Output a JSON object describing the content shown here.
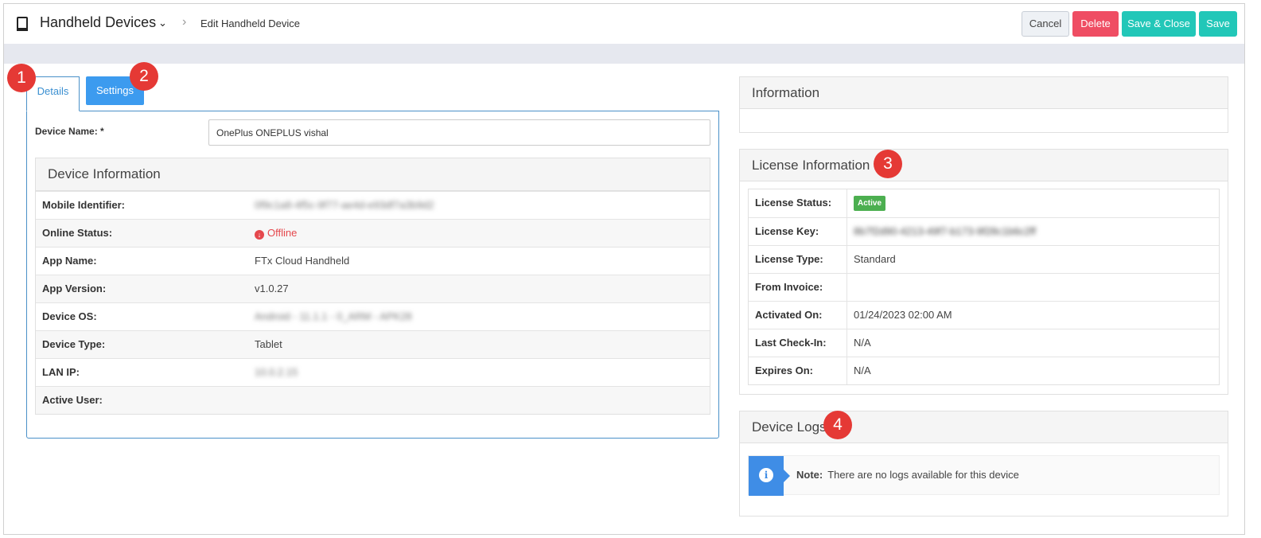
{
  "header": {
    "title": "Handheld Devices",
    "breadcrumb_sep": "›",
    "breadcrumb": "Edit Handheld Device",
    "cancel_label": "Cancel",
    "delete_label": "Delete",
    "save_close_label": "Save & Close",
    "save_label": "Save"
  },
  "tabs": [
    {
      "label": "Details",
      "active": true
    },
    {
      "label": "Settings",
      "active": false
    }
  ],
  "callouts": [
    "1",
    "2",
    "3",
    "4"
  ],
  "details": {
    "device_name_label": "Device Name: *",
    "device_name_value": "OnePlus ONEPLUS vishal",
    "device_info_title": "Device Information",
    "rows": [
      {
        "label": "Mobile Identifier:",
        "value": "0f9c1a8-4f5c-9f77-ae4d-e93df7a3b9d2",
        "blurred": true
      },
      {
        "label": "Online Status:",
        "value": "Offline",
        "status": "offline"
      },
      {
        "label": "App Name:",
        "value": "FTx Cloud Handheld"
      },
      {
        "label": "App Version:",
        "value": "v1.0.27"
      },
      {
        "label": "Device OS:",
        "value": "Android - 11.1.1 - 0_ARM - APK28",
        "blurred": true
      },
      {
        "label": "Device Type:",
        "value": "Tablet"
      },
      {
        "label": "LAN IP:",
        "value": "10.0.2.15",
        "blurred": true
      },
      {
        "label": "Active User:",
        "value": ""
      }
    ]
  },
  "information": {
    "title": "Information"
  },
  "license": {
    "title": "License Information",
    "rows": [
      {
        "label": "License Status:",
        "value": "Active",
        "badge": true
      },
      {
        "label": "License Key:",
        "value": "8b7f2d90-4213-49f7-b173-9f28c1b6c2ff",
        "blurred": true
      },
      {
        "label": "License Type:",
        "value": "Standard"
      },
      {
        "label": "From Invoice:",
        "value": ""
      },
      {
        "label": "Activated On:",
        "value": "01/24/2023 02:00 AM"
      },
      {
        "label": "Last Check-In:",
        "value": "N/A"
      },
      {
        "label": "Expires On:",
        "value": "N/A"
      }
    ]
  },
  "logs": {
    "title": "Device Logs",
    "note_label": "Note:",
    "note_text": "There are no logs available for this device"
  },
  "colors": {
    "accent": "#3c9bef",
    "delete": "#ef4d63",
    "save": "#22c7b8",
    "callout": "#e53935",
    "active": "#4caf50",
    "offline": "#e5484d"
  }
}
